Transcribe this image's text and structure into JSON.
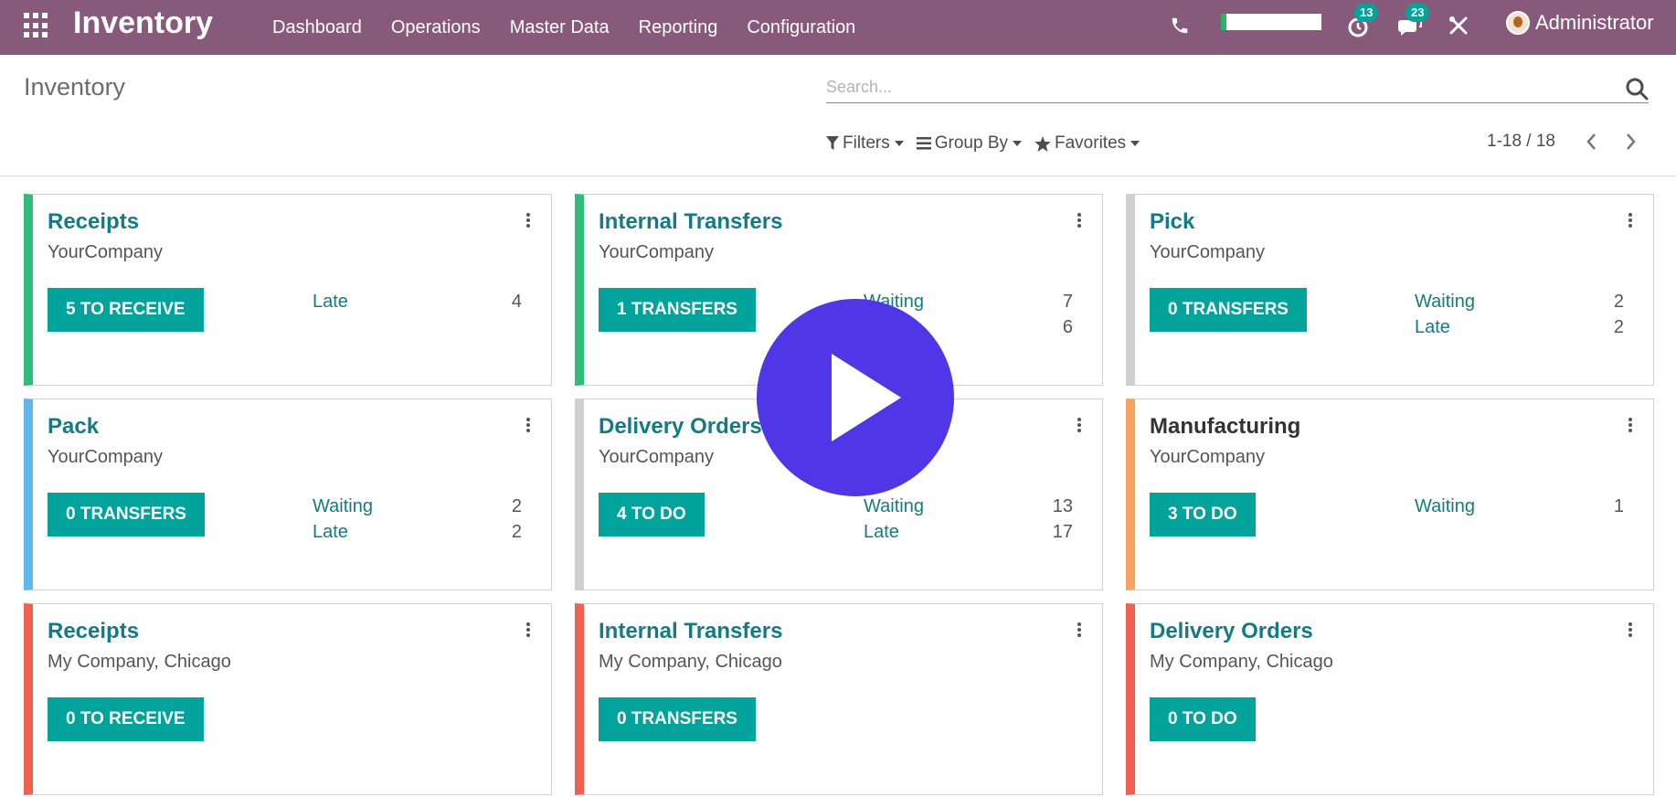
{
  "navbar": {
    "brand": "Inventory",
    "menu": [
      "Dashboard",
      "Operations",
      "Master Data",
      "Reporting",
      "Configuration"
    ],
    "activity_count": "13",
    "message_count": "23",
    "user": "Administrator",
    "color": "#875a7b"
  },
  "control": {
    "breadcrumb": "Inventory",
    "search_placeholder": "Search...",
    "filters_label": "Filters",
    "groupby_label": "Group By",
    "favorites_label": "Favorites",
    "pager": "1-18 / 18"
  },
  "cards": [
    {
      "title": "Receipts",
      "company": "YourCompany",
      "button": "5 TO RECEIVE",
      "color": "#2ebd7a",
      "stats": [
        {
          "label": "Late",
          "value": "4"
        }
      ]
    },
    {
      "title": "Internal Transfers",
      "company": "YourCompany",
      "button": "1 TRANSFERS",
      "color": "#2ebd7a",
      "stats": [
        {
          "label": "Waiting",
          "value": "7"
        },
        {
          "label": "",
          "value": "6"
        }
      ]
    },
    {
      "title": "Pick",
      "company": "YourCompany",
      "button": "0 TRANSFERS",
      "color": "#ffffff",
      "stats": [
        {
          "label": "Waiting",
          "value": "2"
        },
        {
          "label": "Late",
          "value": "2"
        }
      ]
    },
    {
      "title": "Pack",
      "company": "YourCompany",
      "button": "0 TRANSFERS",
      "color": "#5fb7ea",
      "stats": [
        {
          "label": "Waiting",
          "value": "2"
        },
        {
          "label": "Late",
          "value": "2"
        }
      ]
    },
    {
      "title": "Delivery Orders",
      "company": "YourCompany",
      "button": "4 TO DO",
      "color": "#ffffff",
      "stats": [
        {
          "label": "Waiting",
          "value": "13"
        },
        {
          "label": "Late",
          "value": "17"
        }
      ]
    },
    {
      "title": "Manufacturing",
      "company": "YourCompany",
      "button": "3 TO DO",
      "color": "#f4a460",
      "stats": [
        {
          "label": "Waiting",
          "value": "1"
        }
      ]
    },
    {
      "title": "Receipts",
      "company": "My Company, Chicago",
      "button": "0 TO RECEIVE",
      "color": "#f06050",
      "stats": []
    },
    {
      "title": "Internal Transfers",
      "company": "My Company, Chicago",
      "button": "0 TRANSFERS",
      "color": "#f06050",
      "stats": []
    },
    {
      "title": "Delivery Orders",
      "company": "My Company, Chicago",
      "button": "0 TO DO",
      "color": "#f06050",
      "stats": []
    }
  ]
}
